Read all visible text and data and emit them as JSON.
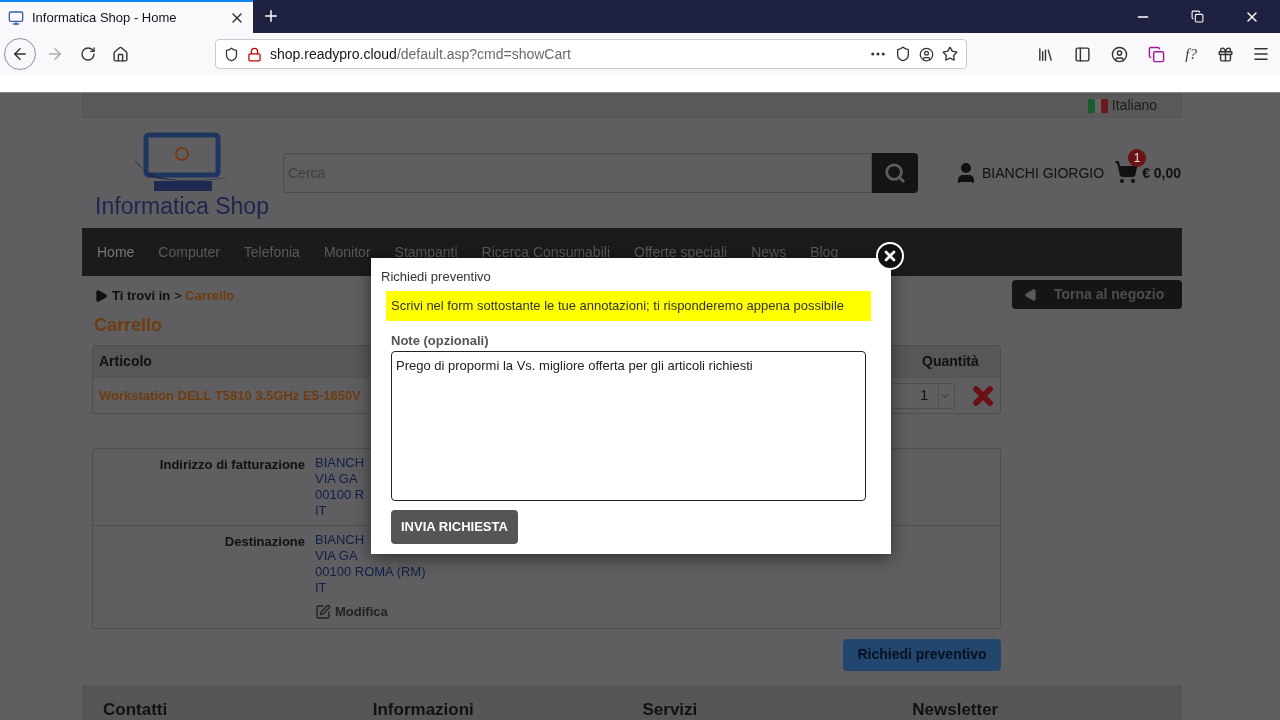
{
  "browser": {
    "tab_title": "Informatica Shop - Home",
    "url_host": "shop.readypro.cloud",
    "url_path": "/default.asp?cmd=showCart",
    "extension_label": "f?"
  },
  "header": {
    "language": "Italiano",
    "logo_text": "Informatica Shop",
    "search_placeholder": "Cerca",
    "user": "BIANCHI GIORGIO",
    "cart_count": "1",
    "cart_total": "€ 0,00"
  },
  "nav": [
    {
      "label": "Home",
      "selected": true
    },
    {
      "label": "Computer",
      "selected": false
    },
    {
      "label": "Telefonia",
      "selected": false
    },
    {
      "label": "Monitor",
      "selected": false
    },
    {
      "label": "Stampanti",
      "selected": false
    },
    {
      "label": "Ricerca Consumabili",
      "selected": false
    },
    {
      "label": "Offerte speciali",
      "selected": false
    },
    {
      "label": "News",
      "selected": false
    },
    {
      "label": "Blog",
      "selected": false
    }
  ],
  "breadcrumb": {
    "prefix": "Ti trovi in",
    "separator": ">",
    "current": "Carrello"
  },
  "back_button": "Torna al negozio",
  "page_title": "Carrello",
  "cart_table": {
    "columns": [
      "Articolo",
      "Quantità"
    ],
    "rows": [
      {
        "article": "Workstation DELL T5810 3.5GHz E5-1650V",
        "quantity": "1"
      }
    ]
  },
  "addresses": [
    {
      "label": "Indirizzo di fatturazione",
      "lines": [
        "BIANCH",
        "VIA GA",
        "00100 R",
        "IT"
      ]
    },
    {
      "label": "Destinazione",
      "lines": [
        "BIANCH",
        "VIA GA",
        "00100 ROMA (RM)",
        "IT"
      ],
      "edit_link": "Modifica"
    }
  ],
  "quote_button": "Richiedi preventivo",
  "footer": [
    "Contatti",
    "Informazioni",
    "Servizi",
    "Newsletter"
  ],
  "modal": {
    "title": "Richiedi preventivo",
    "notice": "Scrivi nel form sottostante le tue annotazioni; ti risponderemo appena possibile",
    "field_label": "Note (opzionali)",
    "note_value": "Prego di propormi la Vs. migliore offerta per gli articoli richiesti",
    "submit": "INVIA RICHIESTA"
  }
}
